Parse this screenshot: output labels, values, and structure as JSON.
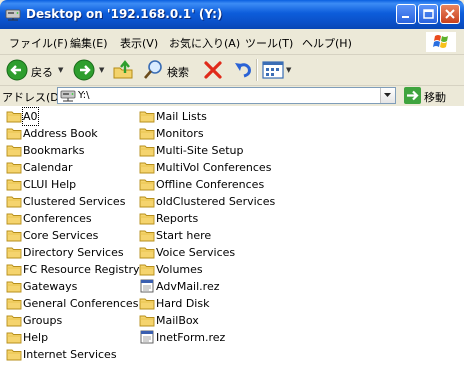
{
  "window": {
    "title": "Desktop on '192.168.0.1' (Y:)"
  },
  "menu": [
    "ファイル(F)",
    "編集(E)",
    "表示(V)",
    "お気に入り(A)",
    "ツール(T)",
    "ヘルプ(H)"
  ],
  "toolbar": {
    "back_label": "戻る",
    "search_label": "検索"
  },
  "address": {
    "label": "アドレス(D)",
    "value": "Y:\\",
    "go_label": "移動"
  },
  "files": {
    "column1": [
      {
        "name": "A0",
        "type": "folder"
      },
      {
        "name": "Address Book",
        "type": "folder"
      },
      {
        "name": "Bookmarks",
        "type": "folder"
      },
      {
        "name": "Calendar",
        "type": "folder"
      },
      {
        "name": "CLUI Help",
        "type": "folder"
      },
      {
        "name": "Clustered Services",
        "type": "folder"
      },
      {
        "name": "Conferences",
        "type": "folder"
      },
      {
        "name": "Core Services",
        "type": "folder"
      },
      {
        "name": "Directory Services",
        "type": "folder"
      },
      {
        "name": "FC Resource Registry",
        "type": "folder"
      },
      {
        "name": "Gateways",
        "type": "folder"
      },
      {
        "name": "General Conferences",
        "type": "folder"
      },
      {
        "name": "Groups",
        "type": "folder"
      },
      {
        "name": "Help",
        "type": "folder"
      },
      {
        "name": "Internet Services",
        "type": "folder"
      }
    ],
    "column2": [
      {
        "name": "Mail Lists",
        "type": "folder"
      },
      {
        "name": "Monitors",
        "type": "folder"
      },
      {
        "name": "Multi-Site Setup",
        "type": "folder"
      },
      {
        "name": "MultiVol Conferences",
        "type": "folder"
      },
      {
        "name": "Offline Conferences",
        "type": "folder"
      },
      {
        "name": "oldClustered Services",
        "type": "folder"
      },
      {
        "name": "Reports",
        "type": "folder"
      },
      {
        "name": "Start here",
        "type": "folder"
      },
      {
        "name": "Voice Services",
        "type": "folder"
      },
      {
        "name": "Volumes",
        "type": "folder"
      },
      {
        "name": "AdvMail.rez",
        "type": "file"
      },
      {
        "name": "Hard Disk",
        "type": "folder"
      },
      {
        "name": "MailBox",
        "type": "folder"
      },
      {
        "name": "InetForm.rez",
        "type": "file"
      }
    ]
  }
}
